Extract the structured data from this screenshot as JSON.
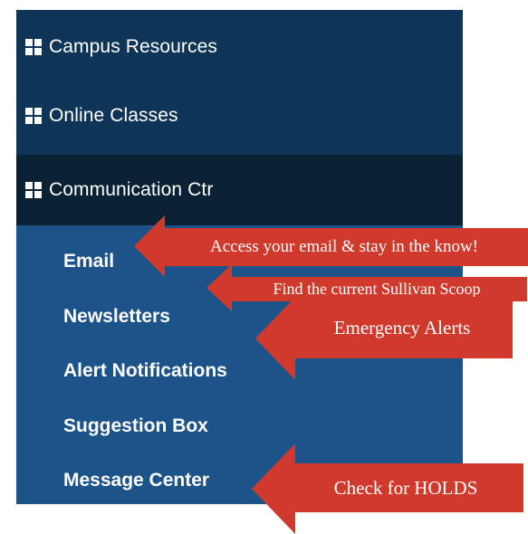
{
  "colors": {
    "nav_dark": "#0e3557",
    "nav_active": "#0a2233",
    "nav_sub": "#1c5389",
    "callout": "#d03a2c",
    "text": "#ffffff"
  },
  "sections": [
    {
      "label": "Campus Resources",
      "icon": "grid-icon"
    },
    {
      "label": "Online Classes",
      "icon": "grid-icon"
    },
    {
      "label": "Communication Ctr",
      "icon": "grid-icon"
    }
  ],
  "sub_items": [
    {
      "label": "Email"
    },
    {
      "label": "Newsletters"
    },
    {
      "label": "Alert Notifications"
    },
    {
      "label": "Suggestion Box"
    },
    {
      "label": "Message Center"
    }
  ],
  "callouts": [
    {
      "text": "Access your email & stay in the know!"
    },
    {
      "text": "Find the current Sullivan Scoop"
    },
    {
      "text": "Emergency Alerts"
    },
    {
      "text": "Check for HOLDS"
    }
  ]
}
